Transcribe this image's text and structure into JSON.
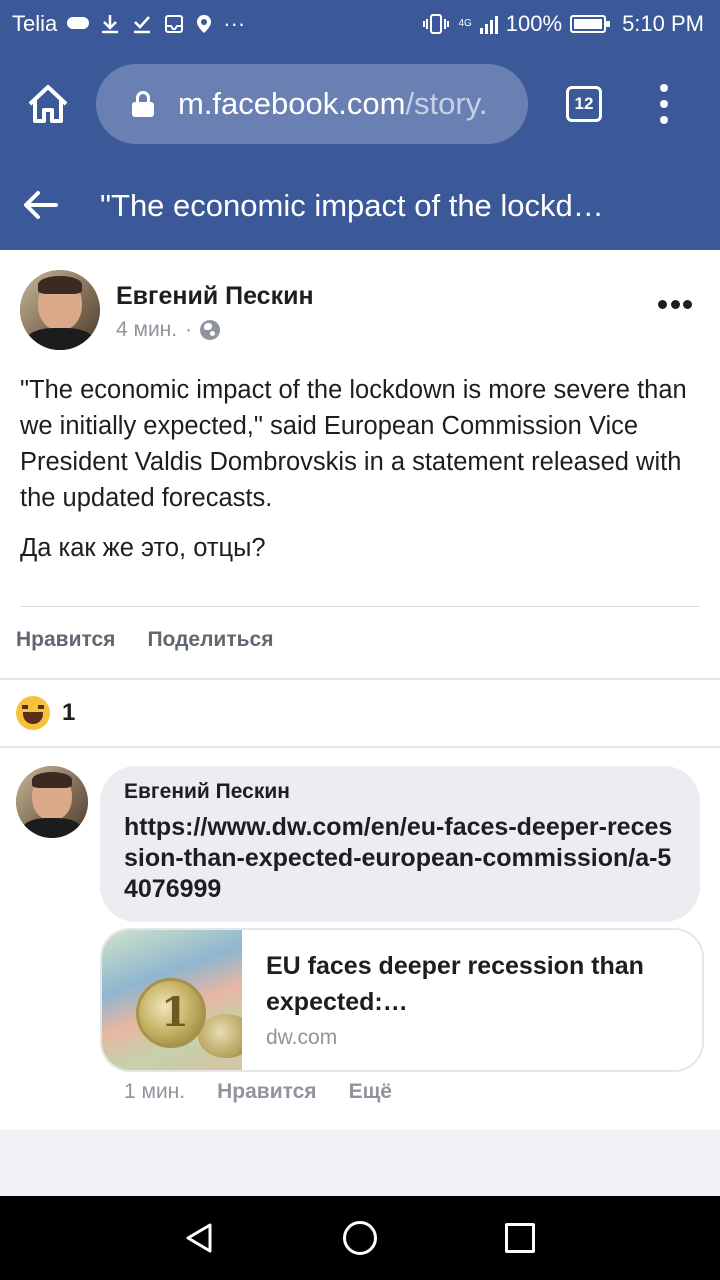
{
  "status_bar": {
    "carrier": "Telia",
    "battery": "100%",
    "time": "5:10 PM",
    "network": "4G",
    "overflow": "···"
  },
  "browser": {
    "url_domain": "m.facebook.com",
    "url_path": "/story.",
    "tab_count": "12"
  },
  "header": {
    "title": "\"The economic impact of the lockd…"
  },
  "post": {
    "author": "Евгений Пескин",
    "time": "4 мин.",
    "separator": "·",
    "text": "\"The economic impact of the lockdown is more severe than we initially expected,\" said European Commission Vice President Valdis Dombrovskis in a statement released with the updated forecasts.",
    "text2": "Да как же это, отцы?",
    "like_label": "Нравится",
    "share_label": "Поделиться",
    "reaction_count": "1"
  },
  "comment": {
    "author": "Евгений Пескин",
    "link_text": "https://www.dw.com/en/eu-faces-deeper-recession-than-expected-european-commission/a-54076999",
    "card_title": "EU faces deeper recession than expected:…",
    "card_domain": "dw.com",
    "time": "1 мин.",
    "like_label": "Нравится",
    "more_label": "Ещё"
  },
  "colors": {
    "facebook_blue": "#3b5998",
    "url_box": "#6a80b3",
    "bubble": "#ebedf0",
    "muted_text": "#90949c"
  }
}
